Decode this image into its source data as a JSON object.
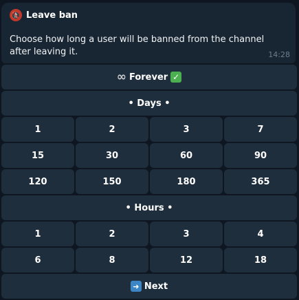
{
  "message": {
    "title": "Leave ban",
    "title_icon": "no-entry-person-icon",
    "text": "Choose how long a user will be banned from the channel after leaving it.",
    "time": "14:28"
  },
  "keyboard": {
    "forever_label": "Forever",
    "forever_prefix_icon": "infinity-icon",
    "forever_check_icon": "check-mark-button-icon",
    "days_header": "• Days •",
    "days": [
      "1",
      "2",
      "3",
      "7",
      "15",
      "30",
      "60",
      "90",
      "120",
      "150",
      "180",
      "365"
    ],
    "hours_header": "• Hours •",
    "hours": [
      "1",
      "2",
      "3",
      "4",
      "6",
      "8",
      "12",
      "18"
    ],
    "next_label": "Next",
    "next_icon": "right-arrow-button-icon"
  },
  "colors": {
    "background": "#0e1621",
    "bubble": "#182533",
    "button": "#1f2e3d",
    "text": "#ffffff",
    "time": "#6d7f8f"
  }
}
